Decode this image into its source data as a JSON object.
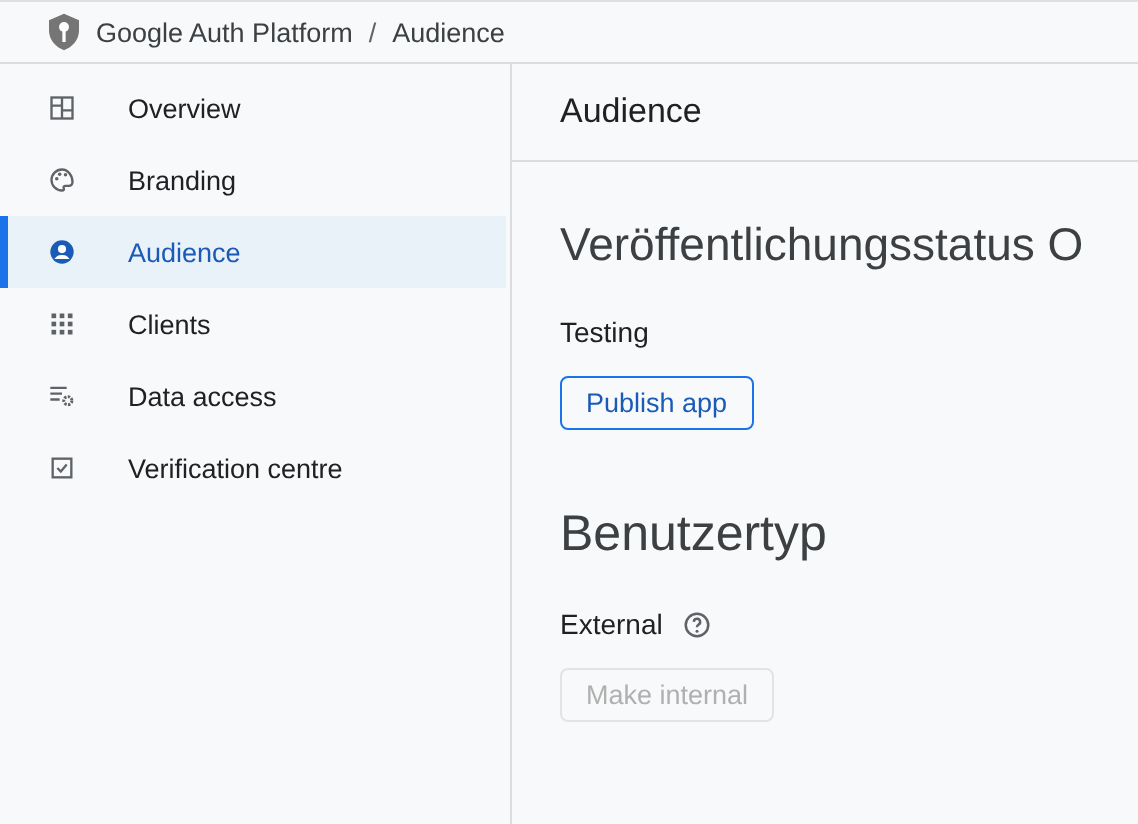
{
  "breadcrumb": [
    "Google Auth Platform",
    "Audience"
  ],
  "breadcrumb_separator": "/",
  "sidebar": {
    "items": [
      {
        "label": "Overview",
        "kind": "dashboard",
        "selected": false
      },
      {
        "label": "Branding",
        "kind": "palette",
        "selected": false
      },
      {
        "label": "Audience",
        "kind": "person",
        "selected": true
      },
      {
        "label": "Clients",
        "kind": "grid",
        "selected": false
      },
      {
        "label": "Data access",
        "kind": "settings",
        "selected": false
      },
      {
        "label": "Verification centre",
        "kind": "checkbox",
        "selected": false
      }
    ]
  },
  "page_title": "Audience",
  "sections": [
    {
      "heading": "Veröffentlichungsstatus O",
      "label": "Testing",
      "help": false,
      "button": {
        "label": "Publish app",
        "disabled": false
      }
    },
    {
      "heading": "Benutzertyp",
      "label": "External",
      "help": true,
      "button": {
        "label": "Make internal",
        "disabled": true
      }
    }
  ]
}
